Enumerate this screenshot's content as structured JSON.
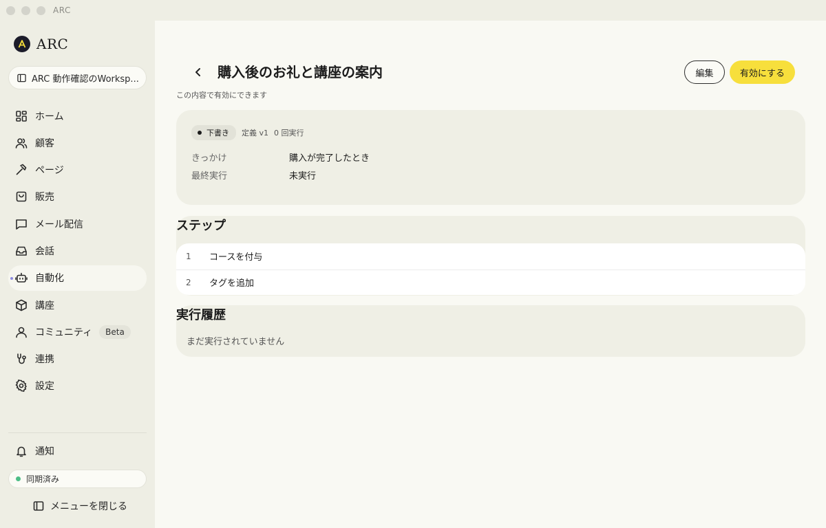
{
  "window": {
    "title": "ARC"
  },
  "sidebar": {
    "logo_text": "ARC",
    "workspace_name": "ARC 動作確認のWorksp...",
    "items": [
      {
        "label": "ホーム",
        "icon": "grid-icon"
      },
      {
        "label": "顧客",
        "icon": "users-icon"
      },
      {
        "label": "ページ",
        "icon": "hammer-icon"
      },
      {
        "label": "販売",
        "icon": "bag-icon"
      },
      {
        "label": "メール配信",
        "icon": "message-icon"
      },
      {
        "label": "会話",
        "icon": "inbox-icon"
      },
      {
        "label": "自動化",
        "icon": "robot-icon"
      },
      {
        "label": "講座",
        "icon": "cube-icon"
      },
      {
        "label": "コミュニティ",
        "icon": "user-icon",
        "badge": "Beta"
      },
      {
        "label": "連携",
        "icon": "link-icon"
      },
      {
        "label": "設定",
        "icon": "gear-icon"
      }
    ],
    "notifications_label": "通知",
    "sync_status": "同期済み",
    "sync_color": "#4cbd86",
    "collapse_label": "メニューを閉じる"
  },
  "header": {
    "title": "購入後のお礼と講座の案内",
    "subtitle": "この内容で有効にできます",
    "edit_label": "編集",
    "enable_label": "有効にする",
    "enable_color": "#f7df3c"
  },
  "info": {
    "status": "下書き",
    "version": "定義 v1",
    "run_count": "0 回実行",
    "trigger_label": "きっかけ",
    "trigger_value": "購入が完了したとき",
    "last_run_label": "最終実行",
    "last_run_value": "未実行"
  },
  "steps": {
    "title": "ステップ",
    "items": [
      {
        "num": "1",
        "label": "コースを付与"
      },
      {
        "num": "2",
        "label": "タグを追加"
      }
    ]
  },
  "history": {
    "title": "実行履歴",
    "empty": "まだ実行されていません"
  }
}
